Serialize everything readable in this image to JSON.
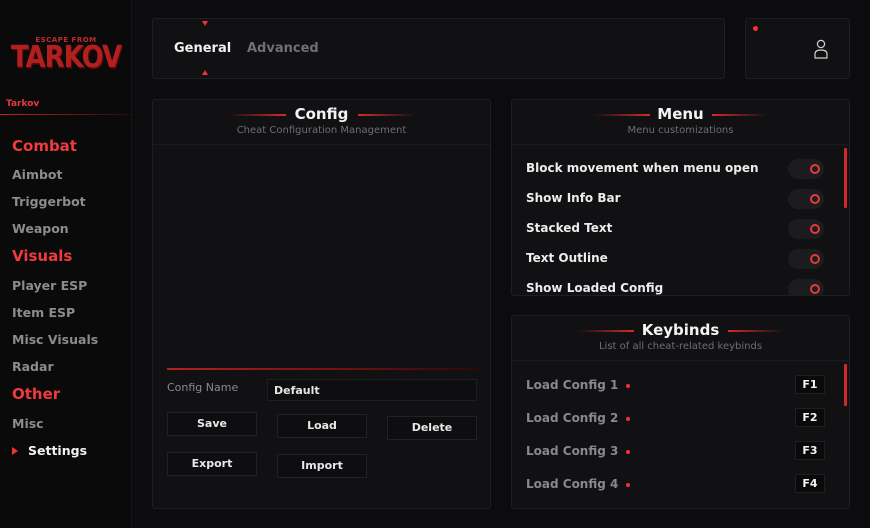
{
  "app": {
    "logo_top": "ESCAPE FROM",
    "logo_main": "TARKOV",
    "game_label": "Tarkov"
  },
  "sidebar": {
    "groups": [
      {
        "label": "Combat",
        "items": [
          "Aimbot",
          "Triggerbot",
          "Weapon"
        ]
      },
      {
        "label": "Visuals",
        "items": [
          "Player ESP",
          "Item ESP",
          "Misc Visuals",
          "Radar"
        ]
      },
      {
        "label": "Other",
        "items": [
          "Misc",
          "Settings"
        ]
      }
    ],
    "active_item": "Settings"
  },
  "tabs": {
    "general": "General",
    "advanced": "Advanced",
    "active": "General"
  },
  "config": {
    "title": "Config",
    "subtitle": "Cheat Configuration Management",
    "name_label": "Config Name",
    "name_value": "Default",
    "buttons": {
      "save": "Save",
      "load": "Load",
      "delete": "Delete",
      "export": "Export",
      "import": "Import"
    }
  },
  "menu": {
    "title": "Menu",
    "subtitle": "Menu customizations",
    "options": [
      {
        "label": "Block movement when menu open",
        "enabled": false
      },
      {
        "label": "Show Info Bar",
        "enabled": false
      },
      {
        "label": "Stacked Text",
        "enabled": false
      },
      {
        "label": "Text Outline",
        "enabled": false
      },
      {
        "label": "Show Loaded Config",
        "enabled": false
      }
    ]
  },
  "keybinds": {
    "title": "Keybinds",
    "subtitle": "List of all cheat-related keybinds",
    "items": [
      {
        "label": "Load Config 1",
        "key": "F1"
      },
      {
        "label": "Load Config 2",
        "key": "F2"
      },
      {
        "label": "Load Config 3",
        "key": "F3"
      },
      {
        "label": "Load Config 4",
        "key": "F4"
      }
    ]
  },
  "colors": {
    "accent": "#e33a3a",
    "background": "#0c0c0e",
    "panel": "#111113"
  },
  "icons": {
    "user": "user-icon",
    "active_marker": "triangle-right-icon"
  }
}
